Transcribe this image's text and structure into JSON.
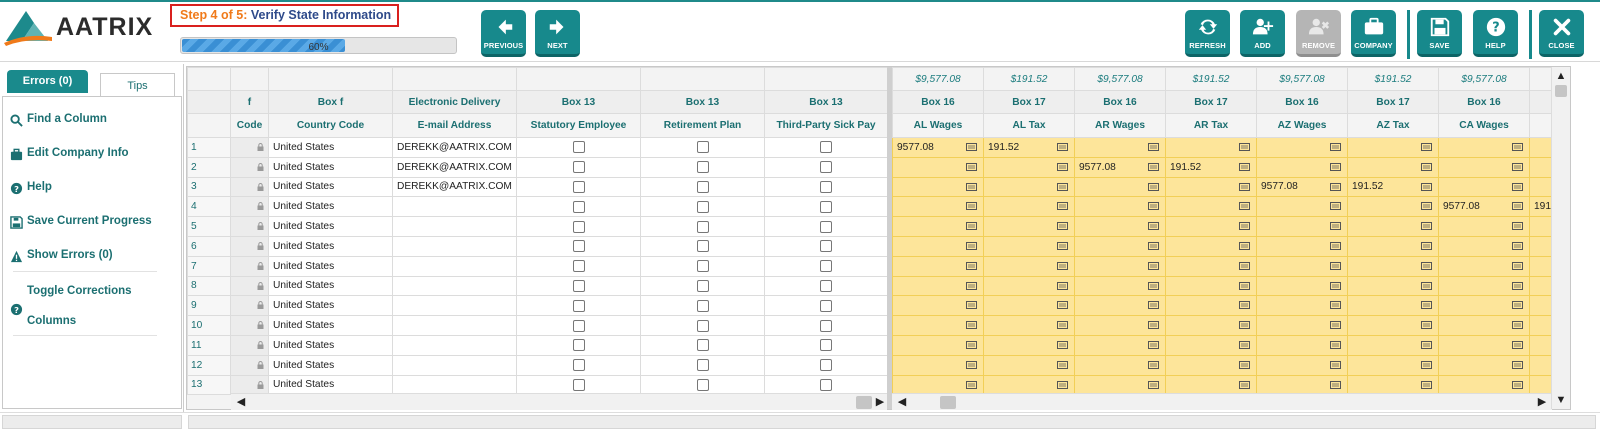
{
  "app": {
    "logo_text": "AATRIX"
  },
  "step": {
    "prefix": "Step 4 of 5:",
    "title": "Verify State Information"
  },
  "progress": {
    "percent": 60,
    "label": "60%"
  },
  "toolbar": {
    "previous": "PREVIOUS",
    "next": "NEXT",
    "refresh": "REFRESH",
    "add": "ADD",
    "remove": "REMOVE",
    "company": "COMPANY",
    "save": "SAVE",
    "help": "HELP",
    "close": "CLOSE"
  },
  "tabs": {
    "errors": "Errors (0)",
    "tips": "Tips"
  },
  "tips": {
    "find_column": "Find a Column",
    "edit_company": "Edit Company Info",
    "help": "Help",
    "save_progress": "Save Current Progress",
    "show_errors": "Show Errors (0)",
    "toggle_line1": "Toggle Corrections",
    "toggle_line2": "Columns"
  },
  "grid": {
    "left_header2": [
      "f",
      "Box f",
      "Electronic Delivery",
      "Box 13",
      "Box 13",
      "Box 13"
    ],
    "left_header3": [
      "Code",
      "Country Code",
      "E-mail Address",
      "Statutory Employee",
      "Retirement Plan",
      "Third-Party Sick Pay"
    ],
    "right_totals": [
      "$9,577.08",
      "$191.52",
      "$9,577.08",
      "$191.52",
      "$9,577.08",
      "$191.52",
      "$9,577.08",
      ""
    ],
    "right_header2": [
      "Box 16",
      "Box 17",
      "Box 16",
      "Box 17",
      "Box 16",
      "Box 17",
      "Box 16",
      ""
    ],
    "right_header3": [
      "AL Wages",
      "AL Tax",
      "AR Wages",
      "AR Tax",
      "AZ Wages",
      "AZ Tax",
      "CA Wages",
      ""
    ],
    "rows": [
      {
        "num": "1",
        "country": "United States",
        "email": "DEREKK@AATRIX.COM",
        "vals": [
          "9577.08",
          "191.52",
          "",
          "",
          "",
          "",
          "",
          ""
        ]
      },
      {
        "num": "2",
        "country": "United States",
        "email": "DEREKK@AATRIX.COM",
        "vals": [
          "",
          "",
          "9577.08",
          "191.52",
          "",
          "",
          "",
          ""
        ]
      },
      {
        "num": "3",
        "country": "United States",
        "email": "DEREKK@AATRIX.COM",
        "vals": [
          "",
          "",
          "",
          "",
          "9577.08",
          "191.52",
          "",
          ""
        ]
      },
      {
        "num": "4",
        "country": "United States",
        "email": "",
        "vals": [
          "",
          "",
          "",
          "",
          "",
          "",
          "9577.08",
          "191"
        ]
      },
      {
        "num": "5",
        "country": "United States",
        "email": "",
        "vals": [
          "",
          "",
          "",
          "",
          "",
          "",
          "",
          ""
        ]
      },
      {
        "num": "6",
        "country": "United States",
        "email": "",
        "vals": [
          "",
          "",
          "",
          "",
          "",
          "",
          "",
          ""
        ]
      },
      {
        "num": "7",
        "country": "United States",
        "email": "",
        "vals": [
          "",
          "",
          "",
          "",
          "",
          "",
          "",
          ""
        ]
      },
      {
        "num": "8",
        "country": "United States",
        "email": "",
        "vals": [
          "",
          "",
          "",
          "",
          "",
          "",
          "",
          ""
        ]
      },
      {
        "num": "9",
        "country": "United States",
        "email": "",
        "vals": [
          "",
          "",
          "",
          "",
          "",
          "",
          "",
          ""
        ]
      },
      {
        "num": "10",
        "country": "United States",
        "email": "",
        "vals": [
          "",
          "",
          "",
          "",
          "",
          "",
          "",
          ""
        ]
      },
      {
        "num": "11",
        "country": "United States",
        "email": "",
        "vals": [
          "",
          "",
          "",
          "",
          "",
          "",
          "",
          ""
        ]
      },
      {
        "num": "12",
        "country": "United States",
        "email": "",
        "vals": [
          "",
          "",
          "",
          "",
          "",
          "",
          "",
          ""
        ]
      },
      {
        "num": "13",
        "country": "United States",
        "email": "",
        "vals": [
          "",
          "",
          "",
          "",
          "",
          "",
          "",
          ""
        ]
      }
    ]
  },
  "colors": {
    "accent": "#17898c",
    "step_prefix": "#f07a1a",
    "step_title": "#2e4a8a",
    "highlight": "#fde59a"
  }
}
